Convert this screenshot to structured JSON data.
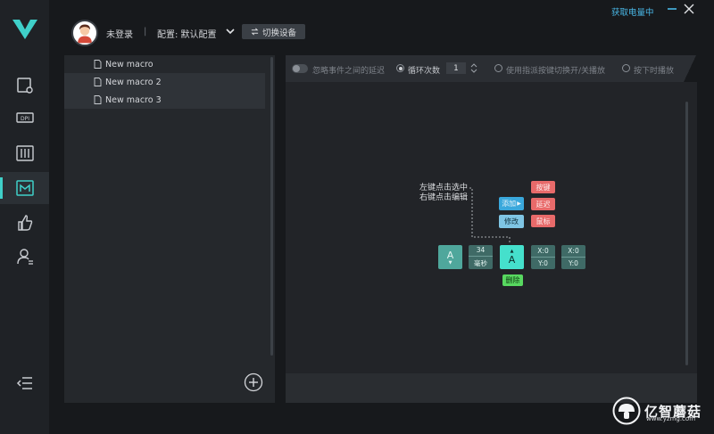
{
  "header": {
    "login_status": "未登录",
    "separator": "|",
    "config_label": "配置: 默认配置",
    "switch_device": "切换设备",
    "power_status": "获取电量中"
  },
  "macros": {
    "items": [
      {
        "label": "New macro"
      },
      {
        "label": "New macro 2"
      },
      {
        "label": "New macro 3"
      }
    ]
  },
  "toolbar": {
    "ignore_delay": "忽略事件之间的延迟",
    "loop_count_label": "循环次数",
    "loop_count_value": "1",
    "toggle_mode": "使用指派按键切换开/关播放",
    "hold_mode": "按下时播放"
  },
  "canvas": {
    "help_line1": "左键点击选中",
    "help_line2": "右键点击编辑",
    "add": "添加",
    "modify": "修改",
    "key": "按键",
    "delay": "延迟",
    "mouse": "鼠标",
    "delete": "删除",
    "node_key": "A",
    "node_delay_value": "34",
    "node_delay_unit": "毫秒",
    "node_selected": "A",
    "node_pos1_x": "X:0",
    "node_pos1_y": "Y:0",
    "node_pos2_x": "X:0",
    "node_pos2_y": "Y:0"
  },
  "watermark": {
    "brand": "亿智蘑菇",
    "url": "www.yzmg.com"
  },
  "colors": {
    "accent": "#3fd0c9",
    "link": "#49b7e6",
    "add_chip": "#3aa8dc",
    "red_chip": "#e86a6a",
    "delete_chip": "#58d860",
    "selected_node": "#45e0cc"
  }
}
